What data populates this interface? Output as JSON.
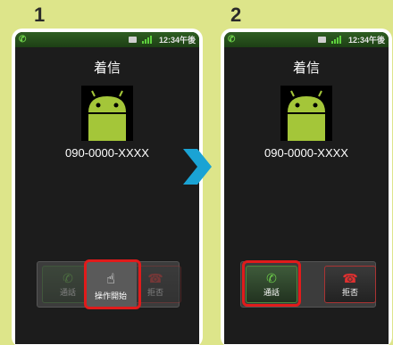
{
  "steps": [
    {
      "number": "1",
      "status_time": "12:34午後",
      "title": "着信",
      "phone_number": "090-0000-XXXX",
      "answer_label": "通話",
      "start_label": "操作開始",
      "decline_label": "拒否"
    },
    {
      "number": "2",
      "status_time": "12:34午後",
      "title": "着信",
      "phone_number": "090-0000-XXXX",
      "answer_label": "通話",
      "decline_label": "拒否"
    }
  ],
  "colors": {
    "background": "#dde58a",
    "highlight": "#e01b1b",
    "arrow": "#1aa3d4",
    "android_green": "#a4c639"
  }
}
